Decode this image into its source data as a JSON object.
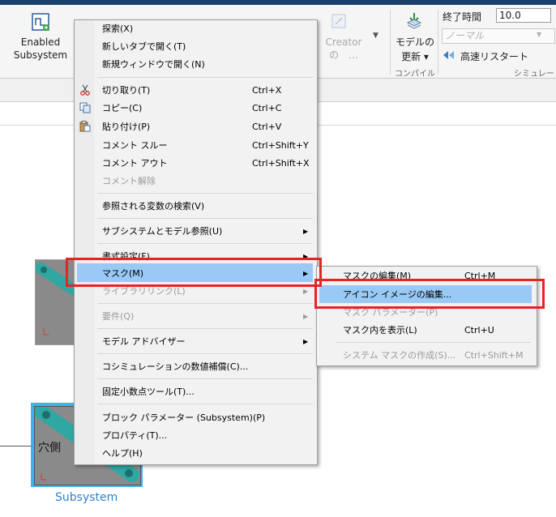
{
  "ribbon": {
    "enabled_subsystem_label": "Enabled\nSubsystem",
    "creator_label": "Creator",
    "creator_ellipsis": "の　…",
    "model_update_label": "モデルの",
    "model_update_label2": "更新 ▾",
    "compile_group": "コンパイル",
    "stop_time_label": "終了時間",
    "stop_time_value": "10.0",
    "sim_mode_value": "ノーマル",
    "fast_restart_label": "高速リスタート",
    "simulation_group": "シミュレーショ"
  },
  "canvas": {
    "subsystem_name": "Subsystem",
    "port_label": "穴側"
  },
  "context_menu": {
    "items": [
      {
        "label": "探索(X)",
        "shortcut": ""
      },
      {
        "label": "新しいタブで開く(T)",
        "shortcut": ""
      },
      {
        "label": "新規ウィンドウで開く(N)",
        "shortcut": ""
      },
      {
        "label": "切り取り(T)",
        "shortcut": "Ctrl+X"
      },
      {
        "label": "コピー(C)",
        "shortcut": "Ctrl+C"
      },
      {
        "label": "貼り付け(P)",
        "shortcut": "Ctrl+V"
      },
      {
        "label": "コメント スルー",
        "shortcut": "Ctrl+Shift+Y"
      },
      {
        "label": "コメント アウト",
        "shortcut": "Ctrl+Shift+X"
      },
      {
        "label": "コメント解除",
        "shortcut": ""
      },
      {
        "label": "参照される変数の検索(V)",
        "shortcut": ""
      },
      {
        "label": "サブシステムとモデル参照(U)",
        "shortcut": ""
      },
      {
        "label": "書式設定(F)",
        "shortcut": ""
      },
      {
        "label": "マスク(M)",
        "shortcut": ""
      },
      {
        "label": "ライブラリリンク(L)",
        "shortcut": ""
      },
      {
        "label": "要件(Q)",
        "shortcut": ""
      },
      {
        "label": "モデル アドバイザー",
        "shortcut": ""
      },
      {
        "label": "コシミュレーションの数値補償(C)...",
        "shortcut": ""
      },
      {
        "label": "固定小数点ツール(T)...",
        "shortcut": ""
      },
      {
        "label": "ブロック パラメーター (Subsystem)(P)",
        "shortcut": ""
      },
      {
        "label": "プロパティ(T)...",
        "shortcut": ""
      },
      {
        "label": "ヘルプ(H)",
        "shortcut": ""
      }
    ]
  },
  "submenu": {
    "items": [
      {
        "label": "マスクの編集(M)",
        "shortcut": "Ctrl+M"
      },
      {
        "label": "アイコン イメージの編集...",
        "shortcut": ""
      },
      {
        "label": "マスク パラメーター(P)",
        "shortcut": ""
      },
      {
        "label": "マスク内を表示(L)",
        "shortcut": "Ctrl+U"
      },
      {
        "label": "システム マスクの作成(S)...",
        "shortcut": "Ctrl+Shift+M"
      }
    ]
  },
  "colors": {
    "highlight": "#99c9f5",
    "annotation_red": "#e32525",
    "selection_blue": "#3cb3ee"
  }
}
